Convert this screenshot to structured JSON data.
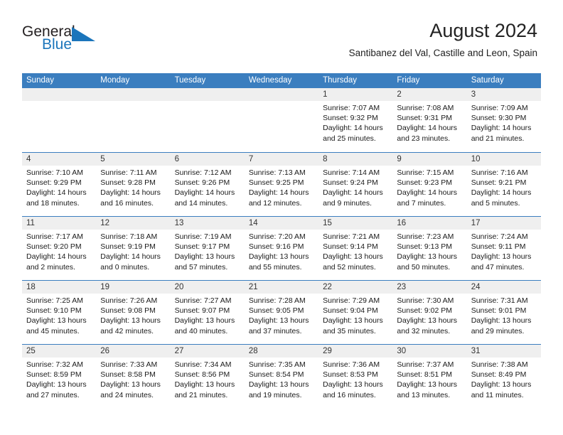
{
  "brand": {
    "word1": "General",
    "word2": "Blue",
    "flag_color": "#1b75bb"
  },
  "header": {
    "title": "August 2024",
    "subtitle": "Santibanez del Val, Castille and Leon, Spain",
    "accent_color": "#3b7ebf",
    "daynum_band_color": "#efefef"
  },
  "weekdays": [
    "Sunday",
    "Monday",
    "Tuesday",
    "Wednesday",
    "Thursday",
    "Friday",
    "Saturday"
  ],
  "weeks": [
    [
      {
        "day": "",
        "sunrise": "",
        "sunset": "",
        "daylight1": "",
        "daylight2": ""
      },
      {
        "day": "",
        "sunrise": "",
        "sunset": "",
        "daylight1": "",
        "daylight2": ""
      },
      {
        "day": "",
        "sunrise": "",
        "sunset": "",
        "daylight1": "",
        "daylight2": ""
      },
      {
        "day": "",
        "sunrise": "",
        "sunset": "",
        "daylight1": "",
        "daylight2": ""
      },
      {
        "day": "1",
        "sunrise": "Sunrise: 7:07 AM",
        "sunset": "Sunset: 9:32 PM",
        "daylight1": "Daylight: 14 hours",
        "daylight2": "and 25 minutes."
      },
      {
        "day": "2",
        "sunrise": "Sunrise: 7:08 AM",
        "sunset": "Sunset: 9:31 PM",
        "daylight1": "Daylight: 14 hours",
        "daylight2": "and 23 minutes."
      },
      {
        "day": "3",
        "sunrise": "Sunrise: 7:09 AM",
        "sunset": "Sunset: 9:30 PM",
        "daylight1": "Daylight: 14 hours",
        "daylight2": "and 21 minutes."
      }
    ],
    [
      {
        "day": "4",
        "sunrise": "Sunrise: 7:10 AM",
        "sunset": "Sunset: 9:29 PM",
        "daylight1": "Daylight: 14 hours",
        "daylight2": "and 18 minutes."
      },
      {
        "day": "5",
        "sunrise": "Sunrise: 7:11 AM",
        "sunset": "Sunset: 9:28 PM",
        "daylight1": "Daylight: 14 hours",
        "daylight2": "and 16 minutes."
      },
      {
        "day": "6",
        "sunrise": "Sunrise: 7:12 AM",
        "sunset": "Sunset: 9:26 PM",
        "daylight1": "Daylight: 14 hours",
        "daylight2": "and 14 minutes."
      },
      {
        "day": "7",
        "sunrise": "Sunrise: 7:13 AM",
        "sunset": "Sunset: 9:25 PM",
        "daylight1": "Daylight: 14 hours",
        "daylight2": "and 12 minutes."
      },
      {
        "day": "8",
        "sunrise": "Sunrise: 7:14 AM",
        "sunset": "Sunset: 9:24 PM",
        "daylight1": "Daylight: 14 hours",
        "daylight2": "and 9 minutes."
      },
      {
        "day": "9",
        "sunrise": "Sunrise: 7:15 AM",
        "sunset": "Sunset: 9:23 PM",
        "daylight1": "Daylight: 14 hours",
        "daylight2": "and 7 minutes."
      },
      {
        "day": "10",
        "sunrise": "Sunrise: 7:16 AM",
        "sunset": "Sunset: 9:21 PM",
        "daylight1": "Daylight: 14 hours",
        "daylight2": "and 5 minutes."
      }
    ],
    [
      {
        "day": "11",
        "sunrise": "Sunrise: 7:17 AM",
        "sunset": "Sunset: 9:20 PM",
        "daylight1": "Daylight: 14 hours",
        "daylight2": "and 2 minutes."
      },
      {
        "day": "12",
        "sunrise": "Sunrise: 7:18 AM",
        "sunset": "Sunset: 9:19 PM",
        "daylight1": "Daylight: 14 hours",
        "daylight2": "and 0 minutes."
      },
      {
        "day": "13",
        "sunrise": "Sunrise: 7:19 AM",
        "sunset": "Sunset: 9:17 PM",
        "daylight1": "Daylight: 13 hours",
        "daylight2": "and 57 minutes."
      },
      {
        "day": "14",
        "sunrise": "Sunrise: 7:20 AM",
        "sunset": "Sunset: 9:16 PM",
        "daylight1": "Daylight: 13 hours",
        "daylight2": "and 55 minutes."
      },
      {
        "day": "15",
        "sunrise": "Sunrise: 7:21 AM",
        "sunset": "Sunset: 9:14 PM",
        "daylight1": "Daylight: 13 hours",
        "daylight2": "and 52 minutes."
      },
      {
        "day": "16",
        "sunrise": "Sunrise: 7:23 AM",
        "sunset": "Sunset: 9:13 PM",
        "daylight1": "Daylight: 13 hours",
        "daylight2": "and 50 minutes."
      },
      {
        "day": "17",
        "sunrise": "Sunrise: 7:24 AM",
        "sunset": "Sunset: 9:11 PM",
        "daylight1": "Daylight: 13 hours",
        "daylight2": "and 47 minutes."
      }
    ],
    [
      {
        "day": "18",
        "sunrise": "Sunrise: 7:25 AM",
        "sunset": "Sunset: 9:10 PM",
        "daylight1": "Daylight: 13 hours",
        "daylight2": "and 45 minutes."
      },
      {
        "day": "19",
        "sunrise": "Sunrise: 7:26 AM",
        "sunset": "Sunset: 9:08 PM",
        "daylight1": "Daylight: 13 hours",
        "daylight2": "and 42 minutes."
      },
      {
        "day": "20",
        "sunrise": "Sunrise: 7:27 AM",
        "sunset": "Sunset: 9:07 PM",
        "daylight1": "Daylight: 13 hours",
        "daylight2": "and 40 minutes."
      },
      {
        "day": "21",
        "sunrise": "Sunrise: 7:28 AM",
        "sunset": "Sunset: 9:05 PM",
        "daylight1": "Daylight: 13 hours",
        "daylight2": "and 37 minutes."
      },
      {
        "day": "22",
        "sunrise": "Sunrise: 7:29 AM",
        "sunset": "Sunset: 9:04 PM",
        "daylight1": "Daylight: 13 hours",
        "daylight2": "and 35 minutes."
      },
      {
        "day": "23",
        "sunrise": "Sunrise: 7:30 AM",
        "sunset": "Sunset: 9:02 PM",
        "daylight1": "Daylight: 13 hours",
        "daylight2": "and 32 minutes."
      },
      {
        "day": "24",
        "sunrise": "Sunrise: 7:31 AM",
        "sunset": "Sunset: 9:01 PM",
        "daylight1": "Daylight: 13 hours",
        "daylight2": "and 29 minutes."
      }
    ],
    [
      {
        "day": "25",
        "sunrise": "Sunrise: 7:32 AM",
        "sunset": "Sunset: 8:59 PM",
        "daylight1": "Daylight: 13 hours",
        "daylight2": "and 27 minutes."
      },
      {
        "day": "26",
        "sunrise": "Sunrise: 7:33 AM",
        "sunset": "Sunset: 8:58 PM",
        "daylight1": "Daylight: 13 hours",
        "daylight2": "and 24 minutes."
      },
      {
        "day": "27",
        "sunrise": "Sunrise: 7:34 AM",
        "sunset": "Sunset: 8:56 PM",
        "daylight1": "Daylight: 13 hours",
        "daylight2": "and 21 minutes."
      },
      {
        "day": "28",
        "sunrise": "Sunrise: 7:35 AM",
        "sunset": "Sunset: 8:54 PM",
        "daylight1": "Daylight: 13 hours",
        "daylight2": "and 19 minutes."
      },
      {
        "day": "29",
        "sunrise": "Sunrise: 7:36 AM",
        "sunset": "Sunset: 8:53 PM",
        "daylight1": "Daylight: 13 hours",
        "daylight2": "and 16 minutes."
      },
      {
        "day": "30",
        "sunrise": "Sunrise: 7:37 AM",
        "sunset": "Sunset: 8:51 PM",
        "daylight1": "Daylight: 13 hours",
        "daylight2": "and 13 minutes."
      },
      {
        "day": "31",
        "sunrise": "Sunrise: 7:38 AM",
        "sunset": "Sunset: 8:49 PM",
        "daylight1": "Daylight: 13 hours",
        "daylight2": "and 11 minutes."
      }
    ]
  ]
}
